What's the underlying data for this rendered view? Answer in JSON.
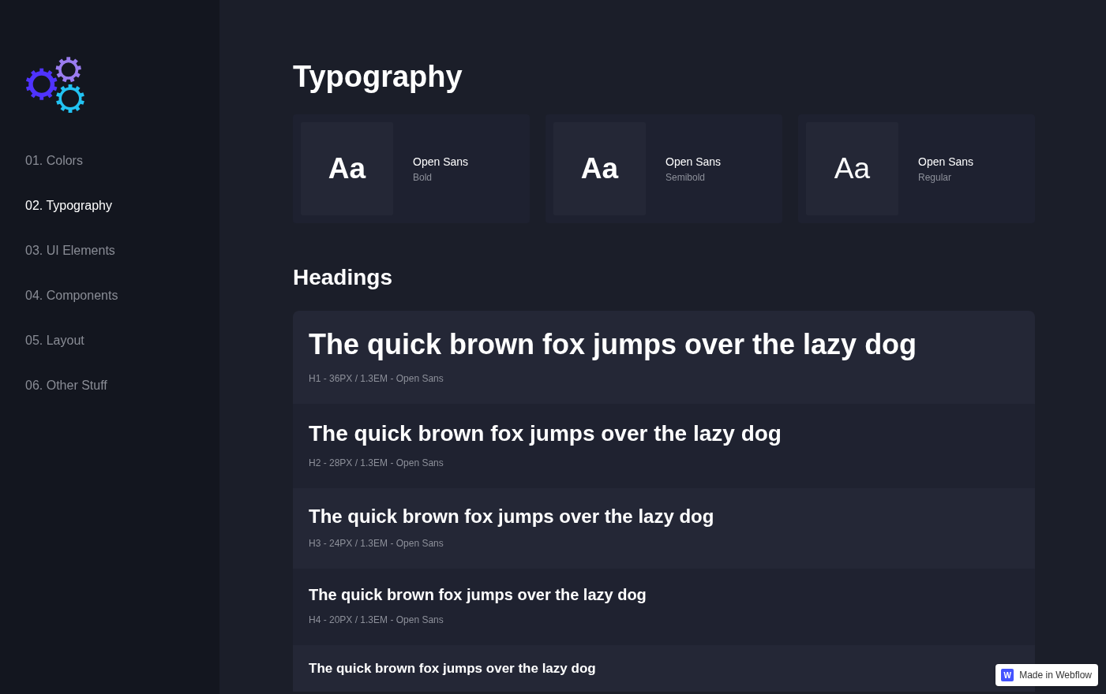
{
  "sidebar": {
    "items": [
      {
        "label": "01. Colors",
        "selected": false
      },
      {
        "label": "02. Typography",
        "selected": true
      },
      {
        "label": "03. UI Elements",
        "selected": false
      },
      {
        "label": "04. Components",
        "selected": false
      },
      {
        "label": "05. Layout",
        "selected": false
      },
      {
        "label": "06. Other Stuff",
        "selected": false
      }
    ]
  },
  "title": "Typography",
  "font_cards": [
    {
      "kind": "bold",
      "sample": "Aa",
      "family": "Open Sans",
      "weight": "Bold"
    },
    {
      "kind": "semibold",
      "sample": "Aa",
      "family": "Open Sans",
      "weight": "Semibold"
    },
    {
      "kind": "regular",
      "sample": "Aa",
      "family": "Open Sans",
      "weight": "Regular"
    }
  ],
  "headings": {
    "title": "Headings",
    "rows": [
      {
        "kind": "h1",
        "sample": "The quick brown fox jumps over the lazy dog",
        "caption": "H1 - 36PX / 1.3EM - Open Sans"
      },
      {
        "kind": "h2",
        "sample": "The quick brown fox jumps over the lazy dog",
        "caption": "H2 - 28PX / 1.3EM - Open Sans"
      },
      {
        "kind": "h3",
        "sample": "The quick brown fox jumps over the lazy dog",
        "caption": "H3 - 24PX / 1.3EM - Open Sans"
      },
      {
        "kind": "h4",
        "sample": "The quick brown fox jumps over the lazy dog",
        "caption": "H4 - 20PX / 1.3EM - Open Sans"
      },
      {
        "kind": "h5",
        "sample": "The quick brown fox jumps over the lazy dog"
      }
    ]
  },
  "badge": {
    "logo": "W",
    "label": "Made in Webflow"
  }
}
